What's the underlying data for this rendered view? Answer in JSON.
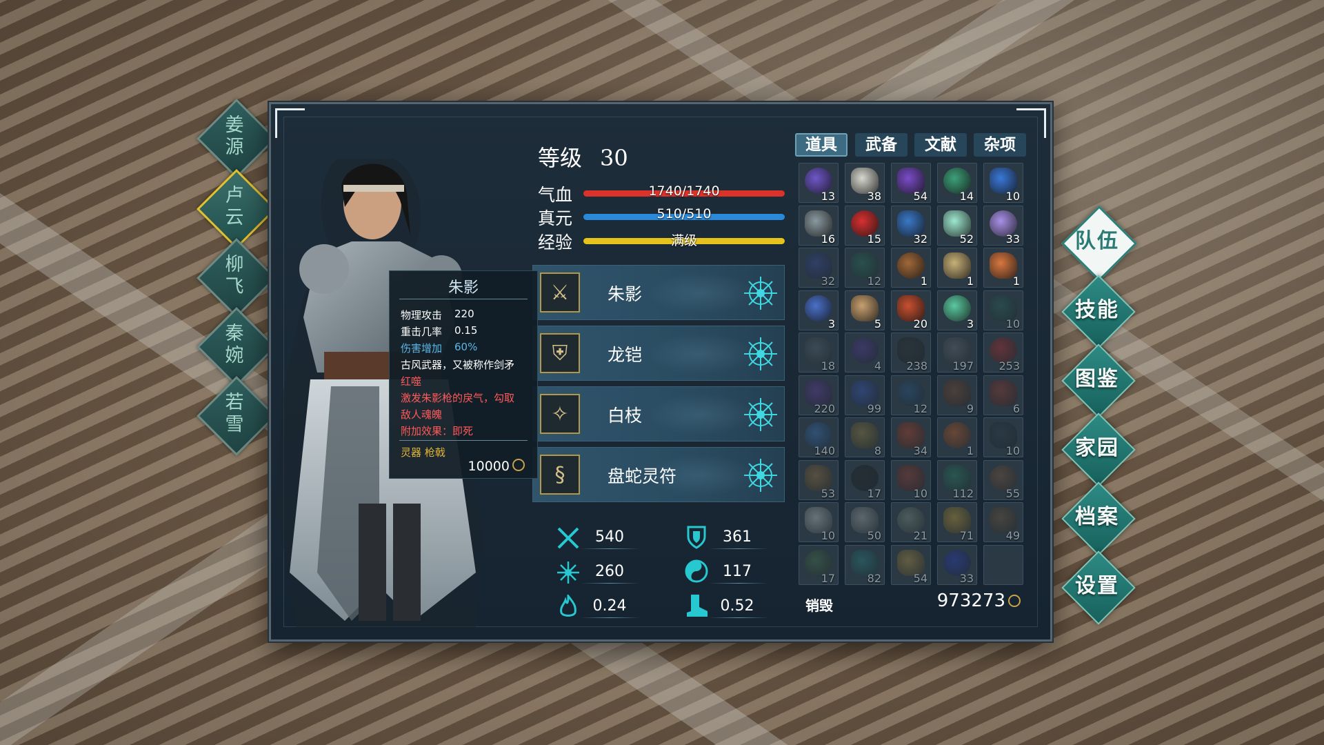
{
  "characters": [
    {
      "label_top": "姜",
      "label_bottom": "源",
      "active": false
    },
    {
      "label_top": "卢",
      "label_bottom": "云",
      "active": true
    },
    {
      "label_top": "柳",
      "label_bottom": "飞",
      "active": false
    },
    {
      "label_top": "秦",
      "label_bottom": "婉",
      "active": false
    },
    {
      "label_top": "若",
      "label_bottom": "雪",
      "active": false
    }
  ],
  "menu": [
    {
      "label": "队伍",
      "active": true
    },
    {
      "label": "技能",
      "active": false
    },
    {
      "label": "图鉴",
      "active": false
    },
    {
      "label": "家园",
      "active": false
    },
    {
      "label": "档案",
      "active": false
    },
    {
      "label": "设置",
      "active": false
    }
  ],
  "level": {
    "label": "等级",
    "value": "30"
  },
  "bars": {
    "hp": {
      "label": "气血",
      "text": "1740/1740",
      "fraction": 1.0,
      "color": "#d9332a"
    },
    "mp": {
      "label": "真元",
      "text": "510/510",
      "fraction": 1.0,
      "color": "#2a8ad9"
    },
    "exp": {
      "label": "经验",
      "text": "满级",
      "fraction": 1.0,
      "color": "#e6c21c"
    }
  },
  "equipment": [
    {
      "name": "朱影",
      "icon": "spear-icon"
    },
    {
      "name": "龙铠",
      "icon": "armor-icon"
    },
    {
      "name": "白枝",
      "icon": "hairpin-icon"
    },
    {
      "name": "盘蛇灵符",
      "icon": "talisman-icon"
    }
  ],
  "tooltip": {
    "title": "朱影",
    "lines": [
      {
        "k": "物理攻击",
        "v": "220"
      },
      {
        "k": "重击几率",
        "v": "0.15"
      },
      {
        "k": "伤害增加",
        "v": "60%"
      }
    ],
    "desc": "古风武器，又被称作剑矛",
    "special_name": "红噬",
    "special_desc1": "激发朱影枪的戾气，勾取",
    "special_desc2": "敌人魂魄",
    "extra": "附加效果：即死",
    "category": "灵器 枪戟",
    "price": "10000"
  },
  "attributes": {
    "attack": "540",
    "defense": "361",
    "spirit": "260",
    "resist": "117",
    "crit": "0.24",
    "dodge": "0.52"
  },
  "inventory_tabs": [
    {
      "label": "道具",
      "active": true
    },
    {
      "label": "武备",
      "active": false
    },
    {
      "label": "文献",
      "active": false
    },
    {
      "label": "杂项",
      "active": false
    }
  ],
  "inventory": [
    {
      "count": "13",
      "icon": "cloth-beads",
      "color": "#6e57c8",
      "dim": false
    },
    {
      "count": "38",
      "icon": "rice-bowl",
      "color": "#d8d8d0",
      "dim": false
    },
    {
      "count": "54",
      "icon": "cloth-beads",
      "color": "#7a4cc8",
      "dim": false
    },
    {
      "count": "14",
      "icon": "herb-pile",
      "color": "#3da07a",
      "dim": false
    },
    {
      "count": "10",
      "icon": "cloth-beads",
      "color": "#3a78d8",
      "dim": false
    },
    {
      "count": "16",
      "icon": "stone-pile",
      "color": "#8a9aa0",
      "dim": false
    },
    {
      "count": "15",
      "icon": "red-ball",
      "color": "#d83030",
      "dim": false
    },
    {
      "count": "32",
      "icon": "blue-box",
      "color": "#3a78c8",
      "dim": false
    },
    {
      "count": "52",
      "icon": "jade-vase",
      "color": "#9ee8d0",
      "dim": false
    },
    {
      "count": "33",
      "icon": "purple-vase",
      "color": "#a890e8",
      "dim": false
    },
    {
      "count": "32",
      "icon": "dark-orb",
      "color": "#3a4aa0",
      "dim": true
    },
    {
      "count": "12",
      "icon": "green-orb",
      "color": "#2a7a60",
      "dim": true
    },
    {
      "count": "1",
      "icon": "clay-jar",
      "color": "#a0683a",
      "dim": false
    },
    {
      "count": "1",
      "icon": "soup-bowl",
      "color": "#c8b078",
      "dim": false
    },
    {
      "count": "1",
      "icon": "soup-bowl",
      "color": "#d87840",
      "dim": false
    },
    {
      "count": "3",
      "icon": "blue-vase",
      "color": "#4a70c8",
      "dim": false
    },
    {
      "count": "5",
      "icon": "wine-jar",
      "color": "#c8a070",
      "dim": false
    },
    {
      "count": "20",
      "icon": "red-gourd",
      "color": "#c85030",
      "dim": false
    },
    {
      "count": "3",
      "icon": "jade-plate",
      "color": "#5ac8a0",
      "dim": false
    },
    {
      "count": "10",
      "icon": "serpent",
      "color": "#2a6a60",
      "dim": true
    },
    {
      "count": "18",
      "icon": "iron-bar",
      "color": "#5a6a78",
      "dim": true
    },
    {
      "count": "4",
      "icon": "purple-gem",
      "color": "#5a3aa0",
      "dim": true
    },
    {
      "count": "238",
      "icon": "black-cloth",
      "color": "#2a2a2a",
      "dim": true
    },
    {
      "count": "197",
      "icon": "grey-stone",
      "color": "#6a7078",
      "dim": true
    },
    {
      "count": "253",
      "icon": "red-ball",
      "color": "#c82828",
      "dim": true
    },
    {
      "count": "220",
      "icon": "purple-crystal",
      "color": "#6a3aa8",
      "dim": true
    },
    {
      "count": "99",
      "icon": "blue-triangle",
      "color": "#3a5ac8",
      "dim": true
    },
    {
      "count": "12",
      "icon": "blue-feather",
      "color": "#2a5a8a",
      "dim": true
    },
    {
      "count": "9",
      "icon": "brown-feather",
      "color": "#8a4a2a",
      "dim": true
    },
    {
      "count": "6",
      "icon": "red-feather",
      "color": "#a83a2a",
      "dim": true
    },
    {
      "count": "140",
      "icon": "blue-leaf",
      "color": "#3a7ac8",
      "dim": true
    },
    {
      "count": "8",
      "icon": "gold-shell",
      "color": "#a88a3a",
      "dim": true
    },
    {
      "count": "34",
      "icon": "red-flower",
      "color": "#c84020",
      "dim": true
    },
    {
      "count": "1",
      "icon": "orange-eye",
      "color": "#d86020",
      "dim": true
    },
    {
      "count": "10",
      "icon": "dark-scroll",
      "color": "#2a3a48",
      "dim": true
    },
    {
      "count": "53",
      "icon": "bamboo-stick",
      "color": "#a8783a",
      "dim": true
    },
    {
      "count": "17",
      "icon": "black-mound",
      "color": "#1a1a1a",
      "dim": true
    },
    {
      "count": "10",
      "icon": "red-scroll",
      "color": "#a83a2a",
      "dim": true
    },
    {
      "count": "112",
      "icon": "green-scales",
      "color": "#2a8a6a",
      "dim": true
    },
    {
      "count": "55",
      "icon": "brown-paw",
      "color": "#8a5a3a",
      "dim": true
    },
    {
      "count": "10",
      "icon": "white-feather",
      "color": "#d8d8d8",
      "dim": true
    },
    {
      "count": "50",
      "icon": "spider-web",
      "color": "#b8b8b8",
      "dim": true
    },
    {
      "count": "21",
      "icon": "pale-leaf",
      "color": "#8a9a8a",
      "dim": true
    },
    {
      "count": "71",
      "icon": "gold-egg",
      "color": "#d8a830",
      "dim": true
    },
    {
      "count": "49",
      "icon": "dark-spore",
      "color": "#7a5a3a",
      "dim": true
    },
    {
      "count": "17",
      "icon": "green-stone",
      "color": "#4a7a4a",
      "dim": true
    },
    {
      "count": "82",
      "icon": "teal-crystal",
      "color": "#2a8a8a",
      "dim": true
    },
    {
      "count": "54",
      "icon": "gold-nuggets",
      "color": "#c8a040",
      "dim": true
    },
    {
      "count": "33",
      "icon": "blue-eye",
      "color": "#2a3ac8",
      "dim": true
    },
    {
      "count": "",
      "icon": "empty",
      "color": "#2a3944",
      "dim": false
    }
  ],
  "footer": {
    "destroy": "销毁",
    "gold": "973273"
  }
}
